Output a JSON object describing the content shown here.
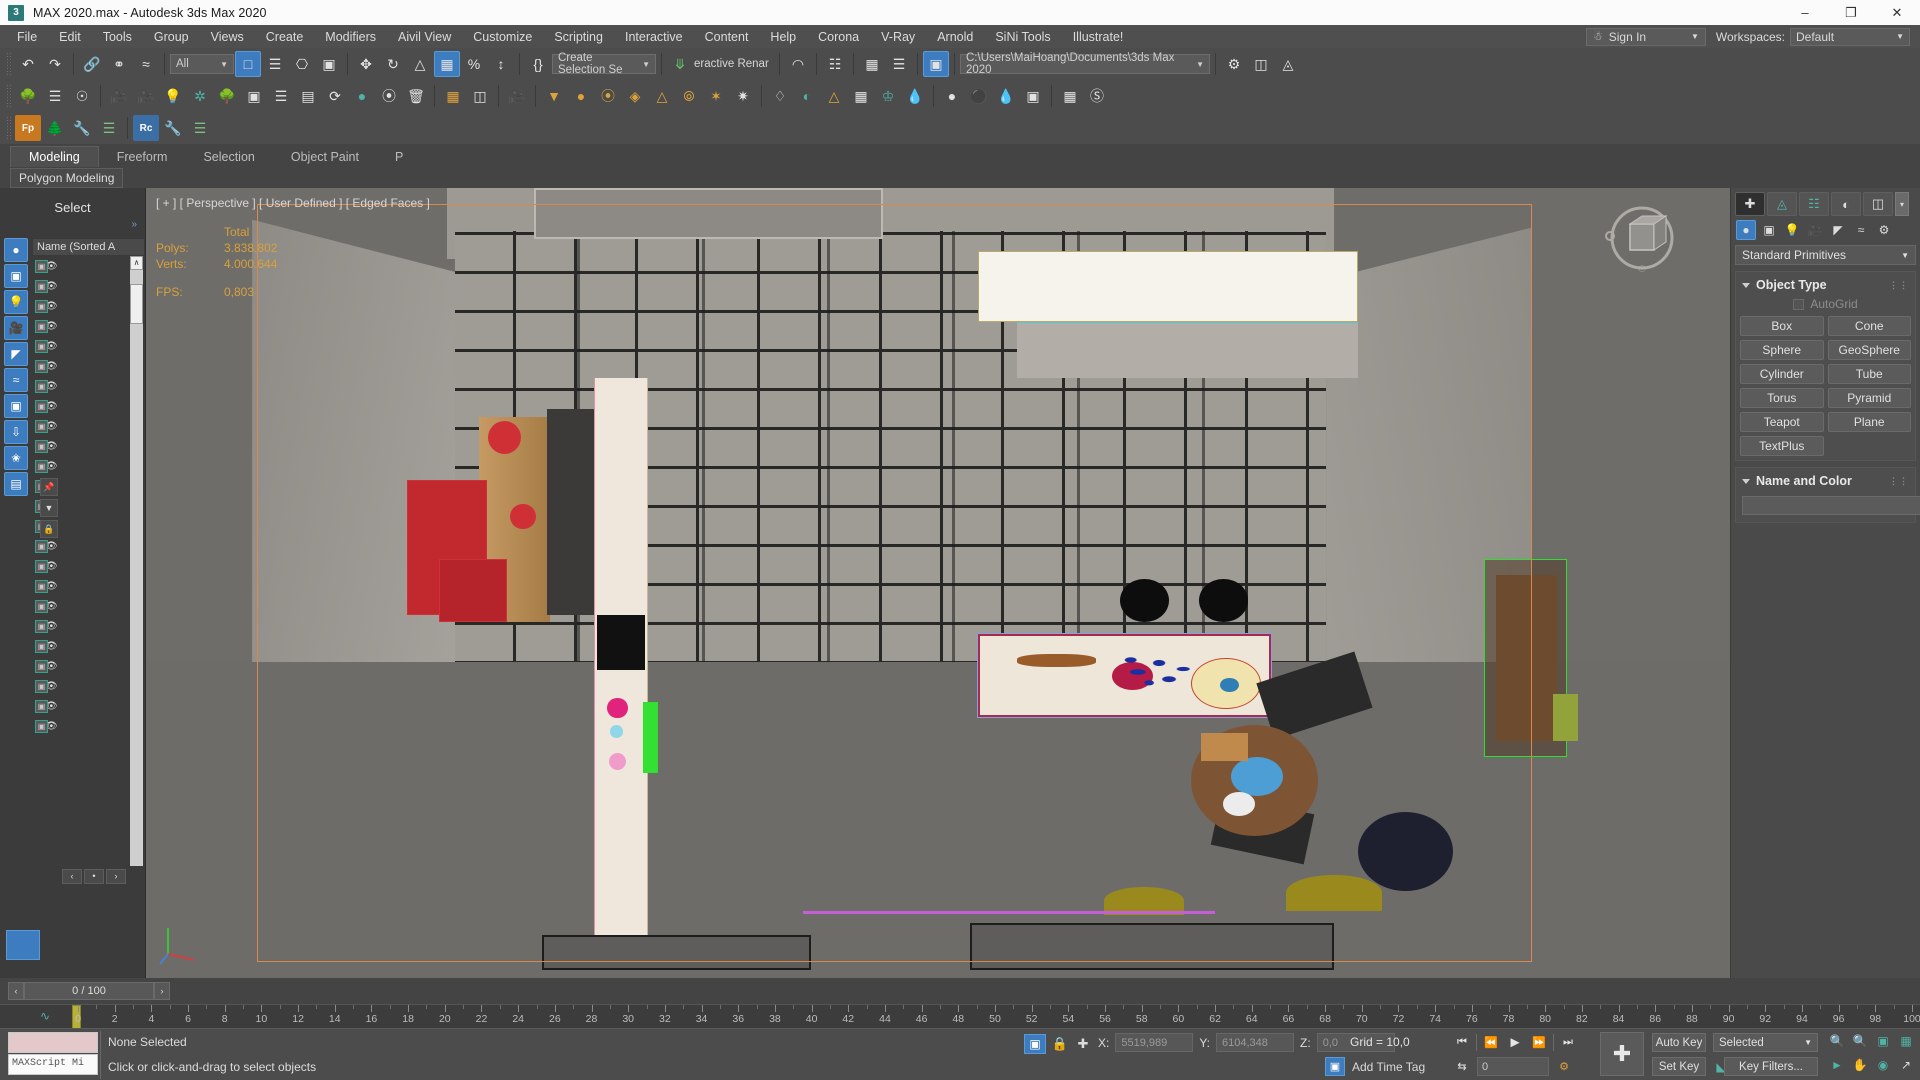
{
  "titlebar": {
    "app_icon": "max-logo-icon",
    "title": "MAX 2020.max - Autodesk 3ds Max 2020",
    "minimize": "–",
    "maximize": "❐",
    "close": "✕"
  },
  "menubar": {
    "items": [
      "File",
      "Edit",
      "Tools",
      "Group",
      "Views",
      "Create",
      "Modifiers",
      "Aivil View",
      "Customize",
      "Scripting",
      "Interactive",
      "Content",
      "Help",
      "Corona",
      "V-Ray",
      "Arnold",
      "SiNi Tools",
      "Illustrate!"
    ],
    "sign_in": "Sign In",
    "workspaces_label": "Workspaces:",
    "workspace_value": "Default"
  },
  "toolbar": {
    "filter_value": "All",
    "selection_set_value": "Create Selection Se",
    "render_label": "eractive Renar",
    "project_path": "C:\\Users\\MaiHoang\\Documents\\3ds Max 2020",
    "row1_icons": [
      "undo-icon",
      "redo-icon",
      "link-icon",
      "unlink-icon",
      "bind-space-warp-icon",
      "select-object-icon",
      "select-by-name-icon",
      "rectangular-region-icon",
      "window-crossing-icon",
      "select-move-icon",
      "select-rotate-icon",
      "select-scale-icon",
      "placement-icon",
      "percent-snap-icon",
      "spinner-snap-icon",
      "edit-named-sets-icon",
      "mirror-icon",
      "align-icon",
      "layer-explorer-icon",
      "curve-editor-icon",
      "schematic-view-icon",
      "material-editor-icon",
      "render-setup-icon",
      "render-frame-icon",
      "render-production-icon"
    ],
    "row2_icons": [
      "forest-pack-icon",
      "railclone-icon",
      "help-icon",
      "camera-icon",
      "camera-add-icon",
      "light-omni-icon",
      "light-point-icon",
      "tree-icon",
      "proxy-icon",
      "list-icon",
      "door-icon",
      "spiral-icon",
      "apple-icon",
      "leaf-icon",
      "trash-icon",
      "column-icon",
      "scanner-icon",
      "film-camera-icon",
      "target-light-icon",
      "dome-light-icon",
      "area-light-icon",
      "mesh-light-icon",
      "spot-light-icon",
      "ies-light-icon",
      "sun-icon",
      "sparkle-icon",
      "plant-icon",
      "sphere-proxy-icon",
      "pyramid-icon",
      "grid-icon",
      "grass-icon",
      "drop-icon",
      "sphere-icon",
      "balloon-icon",
      "water-icon",
      "clone-icon",
      "chart-icon",
      "vray-icon"
    ],
    "row3_icons": [
      "forestpack-orange-icon",
      "tree-green-icon",
      "wrench-icon",
      "list-green-icon",
      "railclone-blue-icon",
      "wrench2-icon",
      "list-green2-icon"
    ]
  },
  "ribbon": {
    "tabs": [
      "Modeling",
      "Freeform",
      "Selection",
      "Object Paint",
      "P"
    ],
    "active_tab": "Modeling",
    "subtab": "Polygon Modeling"
  },
  "leftpanel": {
    "title": "Select",
    "expand_glyph": "»",
    "column_header": "Name (Sorted A",
    "row_count": 24,
    "icons": [
      "all-objects-icon",
      "geometry-icon",
      "lights-icon",
      "cameras-icon",
      "helpers-icon",
      "space-warps-icon",
      "group-icon",
      "xref-icon",
      "bone-icon",
      "container-icon"
    ],
    "scroll_up": "∧",
    "scroll_down": "∨",
    "footer_buttons": [
      "‹",
      "•",
      "›"
    ]
  },
  "viewport": {
    "label": "[ + ] [ Perspective ] [ User Defined ] [ Edged Faces ]",
    "stats": {
      "column_header": "Total",
      "polys_label": "Polys:",
      "polys_value": "3.838.802",
      "verts_label": "Verts:",
      "verts_value": "4.000.644",
      "fps_label": "FPS:",
      "fps_value": "0,803"
    },
    "viewcube": "view-cube-icon",
    "axis_tripod": "axis-tripod-icon"
  },
  "commandpanel": {
    "tabs": [
      "create-tab-icon",
      "modify-tab-icon",
      "hierarchy-tab-icon",
      "motion-tab-icon",
      "display-tab-icon",
      "utilities-tab-icon"
    ],
    "more_caret": "▾",
    "category_icons": [
      "geometry-icon",
      "shapes-icon",
      "lights-icon",
      "cameras-icon",
      "helpers-icon",
      "space-warps-icon",
      "systems-icon"
    ],
    "dropdown_value": "Standard Primitives",
    "object_type": {
      "title": "Object Type",
      "autogrid": "AutoGrid",
      "buttons": [
        "Box",
        "Cone",
        "Sphere",
        "GeoSphere",
        "Cylinder",
        "Tube",
        "Torus",
        "Pyramid",
        "Teapot",
        "Plane",
        "TextPlus"
      ]
    },
    "name_and_color": {
      "title": "Name and Color",
      "name_value": "",
      "color": "#e6209a"
    }
  },
  "timeslider": {
    "prev_glyph": "‹",
    "next_glyph": "›",
    "frame_text": "0 / 100"
  },
  "trackbar": {
    "curve_icon": "curve-editor-icon",
    "ticks": [
      0,
      2,
      4,
      6,
      8,
      10,
      12,
      14,
      16,
      18,
      20,
      22,
      24,
      26,
      28,
      30,
      32,
      34,
      36,
      38,
      40,
      42,
      44,
      46,
      48,
      50,
      52,
      54,
      56,
      58,
      60,
      62,
      64,
      66,
      68,
      70,
      72,
      74,
      76,
      78,
      80,
      82,
      84,
      86,
      88,
      90,
      92,
      94,
      96,
      98,
      100
    ]
  },
  "statusbar": {
    "maxscript_label": "MAXScript Mi",
    "selection_status": "None Selected",
    "hint": "Click or click-and-drag to select objects",
    "lock_icon": "lock-selection-icon",
    "selection_lock_icon": "selection-lock-icon",
    "absolute_icon": "absolute-mode-icon",
    "x_label": "X:",
    "x_value": "5519,989",
    "y_label": "Y:",
    "y_value": "6104,348",
    "z_label": "Z:",
    "z_value": "0,0",
    "grid_label": "Grid = 10,0",
    "add_time_tag": "Add Time Tag",
    "auto_key": "Auto Key",
    "set_key": "Set Key",
    "key_mode_value": "Selected",
    "key_filters": "Key Filters...",
    "playback": [
      "go-to-start-icon",
      "previous-frame-icon",
      "play-animation-icon",
      "next-frame-icon",
      "go-to-end-icon"
    ],
    "frame_value": "0",
    "nav_icons_row1": [
      "zoom-icon",
      "zoom-all-icon",
      "zoom-extents-icon",
      "zoom-region-icon"
    ],
    "nav_icons_row2": [
      "field-of-view-icon",
      "pan-view-icon",
      "orbit-icon",
      "maximize-viewport-icon"
    ]
  },
  "colors": {
    "accent_blue": "#3d7cbf",
    "stats_orange": "#d8a13a",
    "panel_bg": "#4c4c4c",
    "viewport_bg": "#6f6d6a",
    "selection_red": "#d0303a",
    "selection_green": "#2ee02e",
    "swatch_pink": "#e6209a",
    "playhead_yellow": "#b9b038"
  }
}
